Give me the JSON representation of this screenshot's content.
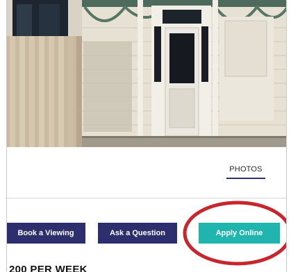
{
  "listing": {
    "photo_alt": "House front porch"
  },
  "tabs": {
    "photos_label": "PHOTOS"
  },
  "actions": {
    "book_viewing_label": "Book a Viewing",
    "ask_question_label": "Ask a Question",
    "apply_online_label": "Apply Online"
  },
  "price": {
    "text": "200 PER WEEK"
  },
  "colors": {
    "navy": "#2c2e6d",
    "teal": "#1fb5ae",
    "annotation_red": "#c8262c"
  }
}
